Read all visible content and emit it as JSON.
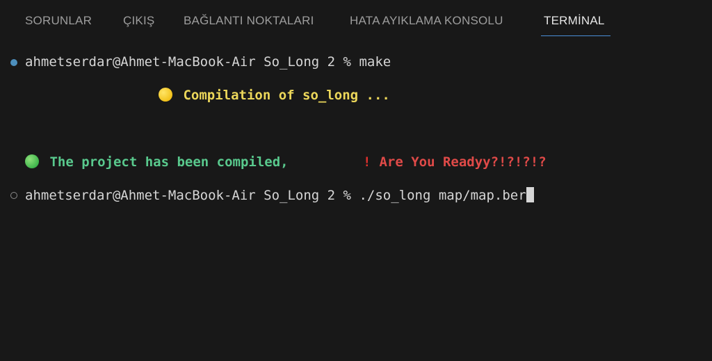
{
  "tabs": [
    {
      "label": "SORUNLAR",
      "active": false
    },
    {
      "label": "ÇIKIŞ",
      "active": false
    },
    {
      "label": "BAĞLANTI NOKTALARI",
      "active": false
    },
    {
      "label": "HATA AYIKLAMA KONSOLU",
      "active": false
    },
    {
      "label": "TERMİNAL",
      "active": true
    }
  ],
  "terminal": {
    "line1": {
      "prompt": "ahmetserdar@Ahmet-MacBook-Air So_Long 2 % ",
      "command": "make"
    },
    "compile_msg": "Compilation of so_long ...",
    "success_msg": "The project has been compiled,",
    "ready_msg": "Are You Readyy?!?!?!?",
    "line2": {
      "prompt": "ahmetserdar@Ahmet-MacBook-Air So_Long 2 % ",
      "command": "./so_long map/map.ber"
    }
  },
  "icons": {
    "status_done": "filled-circle-icon",
    "status_idle": "hollow-circle-icon",
    "compile": "yellow-circle-emoji",
    "success": "green-circle-emoji",
    "alert": "exclamation-emoji"
  },
  "colors": {
    "background": "#181818",
    "accent": "#4a8fd9",
    "yellow": "#ecd75a",
    "green": "#59c98d",
    "red": "#e04a48"
  }
}
